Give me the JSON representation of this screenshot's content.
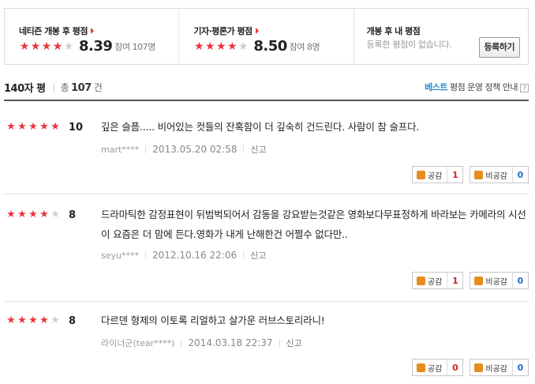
{
  "summary": {
    "netizen": {
      "title": "네티즌 개봉 후 평점",
      "stars_filled": 4,
      "score": "8.39",
      "count_text": "참여 107명"
    },
    "critic": {
      "title": "기자·평론가 평점",
      "stars_filled": 4,
      "score": "8.50",
      "count_text": "참여 8명"
    },
    "mine": {
      "title": "개봉 후 내 평점",
      "text": "등록한 평점이 없습니다.",
      "button_label": "등록하기"
    }
  },
  "list_header": {
    "title": "140자 평",
    "total_prefix": "총",
    "total_count": "107",
    "total_suffix": "건",
    "best_label": "베스트",
    "policy_label": "평점 운영 정책 안내",
    "help_icon_text": "?"
  },
  "reviews": [
    {
      "stars_filled": 5,
      "score": "10",
      "text": "깊은 슬픔..... 비어있는 컷들의 잔혹함이 더 깊숙히 건드린다. 사람이 참 슬프다.",
      "author": "mart****",
      "date": "2013.05.20 02:58",
      "report": "신고",
      "like_label": "공감",
      "like_count": "1",
      "dislike_label": "비공감",
      "dislike_count": "0"
    },
    {
      "stars_filled": 4,
      "score": "8",
      "text": "드라마틱한 감정표현이 뒤범벅되어서 감동을 강요받는것같은 영화보다무표정하게 바라보는 카메라의 시선이 요즘은 더 맘에 든다.영화가 내게 난해한건 어쩔수 없다만..",
      "author": "seyu****",
      "date": "2012.10.16 22:06",
      "report": "신고",
      "like_label": "공감",
      "like_count": "1",
      "dislike_label": "비공감",
      "dislike_count": "0"
    },
    {
      "stars_filled": 4,
      "score": "8",
      "text": "다르덴 형제의 이토록 리얼하고 살가운 러브스토리라니!",
      "author": "라이너군(tear****)",
      "date": "2014.03.18 22:37",
      "report": "신고",
      "like_label": "공감",
      "like_count": "0",
      "dislike_label": "비공감",
      "dislike_count": "0"
    }
  ],
  "colors": {
    "star_on": "#e8353d",
    "star_off": "#cfcfcf",
    "accent_blue": "#2b8bd0",
    "like_red": "#d31f26",
    "dislike_blue": "#1d6ec9"
  }
}
